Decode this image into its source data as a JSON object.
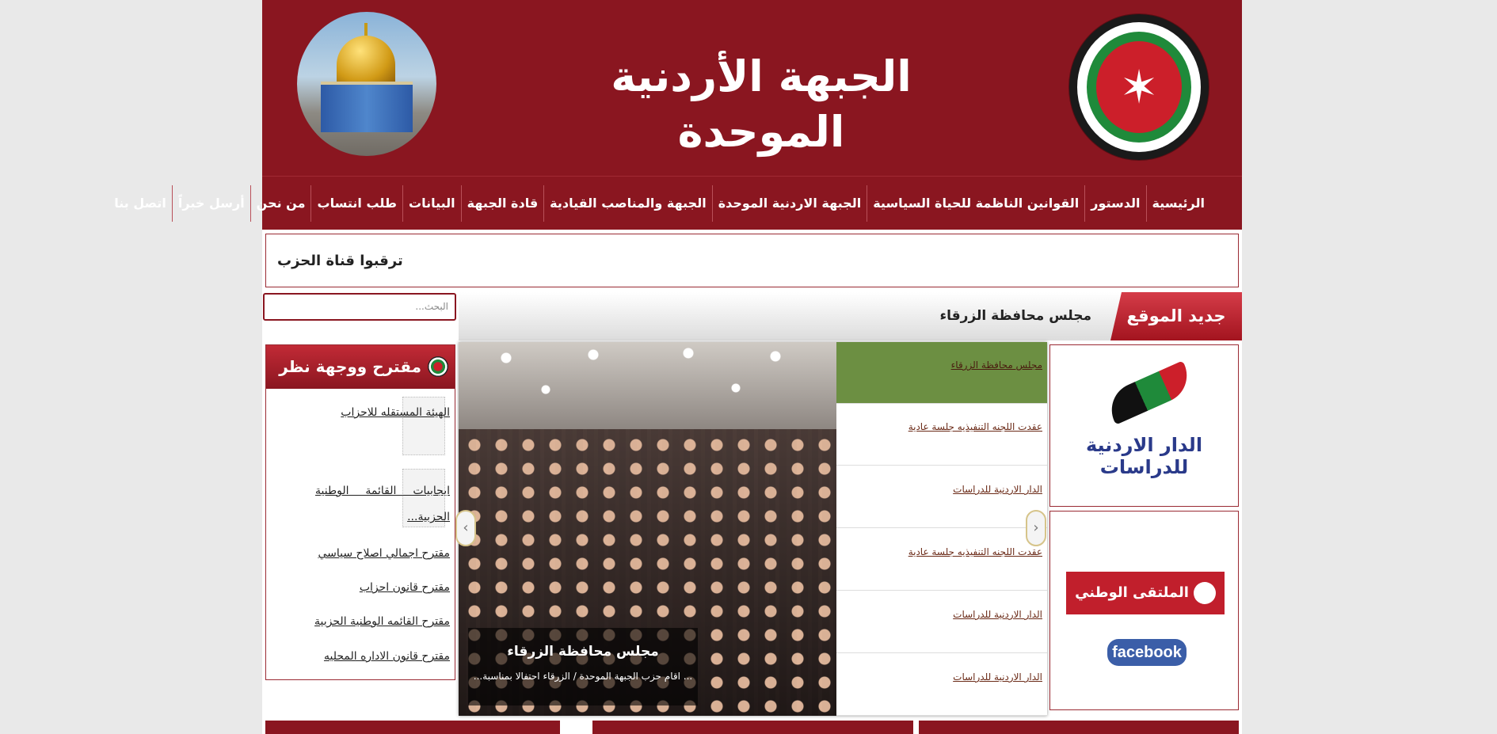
{
  "header": {
    "site_title": "الجبهة الأردنية الموحدة"
  },
  "nav": {
    "items": [
      "الرئيسية",
      "الدستور",
      "القوانين الناظمة للحياة السياسية",
      "الجبهة الاردنية الموحدة",
      "الجبهة والمناصب القيادية",
      "قادة الجبهة",
      "البيانات",
      "طلب انتساب",
      "من نحن",
      "أرسل خبراً",
      "اتصل بنا"
    ]
  },
  "channel": {
    "text": "ترقبوا قناة الحزب"
  },
  "search": {
    "placeholder": "البحث..."
  },
  "ticker": {
    "badge": "جديد الموقع",
    "headline": "مجلس محافظة الزرقاء"
  },
  "sidebar": {
    "title": "مقترح ووجهة نظر",
    "entries": [
      "الهيئة المستقله للاحزاب",
      "ايجابيات القائمة الوطنية الحزبية...",
      "مقترح اجمالي اصلاح سياسي",
      "مقترح قانون احزاب",
      "مقترح القائمه الوطنية الحزبية",
      "مقترح قانون الاداره المحليه"
    ]
  },
  "slider": {
    "caption_title": "مجلس محافظة الزرقاء",
    "caption_desc": "... اقام حزب الجبهة الموحدة / الزرقاء  احتفالا  بمناسبة...",
    "list": [
      "مجلس محافظة الزرقاء",
      "عقدت اللجنه التنفيذيه جلسة عادية",
      "الدار الاردنية للدراسات",
      "عقدت اللجنه التنفيذيه جلسة عادية",
      "الدار الاردنية للدراسات",
      "الدار الاردنية للدراسات"
    ],
    "active_index": 0
  },
  "right": {
    "dar_text": "الدار الاردنية للدراسات",
    "youth_text": "الملتقى الوطني للشباب",
    "facebook": "facebook"
  },
  "colors": {
    "brand": "#8a1620",
    "active_slide_item": "#6c8f42"
  }
}
